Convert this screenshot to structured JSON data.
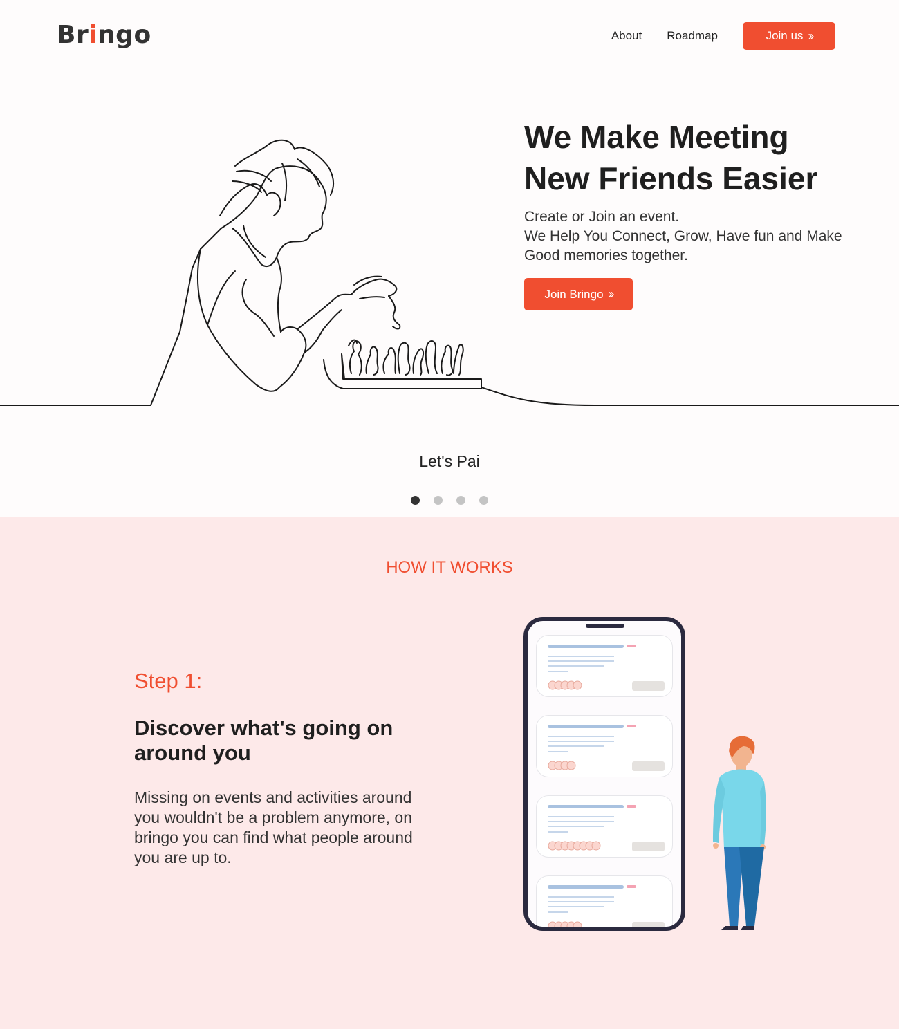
{
  "header": {
    "logo_prefix": "Br",
    "logo_accent": "i",
    "logo_suffix": "ngo",
    "nav": [
      "About",
      "Roadmap"
    ],
    "cta_label": "Join us"
  },
  "hero": {
    "title_line1": "We Make Meeting",
    "title_line2": "New Friends Easier",
    "sub_line1": "Create or Join an event.",
    "sub_line2": "We Help You Connect, Grow, Have fun and Make Good memories together.",
    "cta_label": "Join Bringo"
  },
  "carousel": {
    "caption": "Let's Pai",
    "active_index": 0,
    "slide_count": 4
  },
  "how_it_works": {
    "title": "HOW IT WORKS",
    "step_label": "Step 1:",
    "step_title": "Discover what's going on around you",
    "step_description": "Missing on events and activities around you wouldn't be a problem anymore, on bringo you can find what people around you are up to."
  },
  "colors": {
    "accent": "#f04e30",
    "section_bg": "#fde9e9",
    "page_bg": "#fefcfc",
    "phone_frame": "#2b2a3f",
    "shirt": "#79d7ea",
    "pants": "#1f6aa3",
    "hair": "#e66c37"
  },
  "icons": [
    "double-chevron-right-icon",
    "phone-illustration",
    "person-illustration",
    "chess-line-illustration"
  ]
}
